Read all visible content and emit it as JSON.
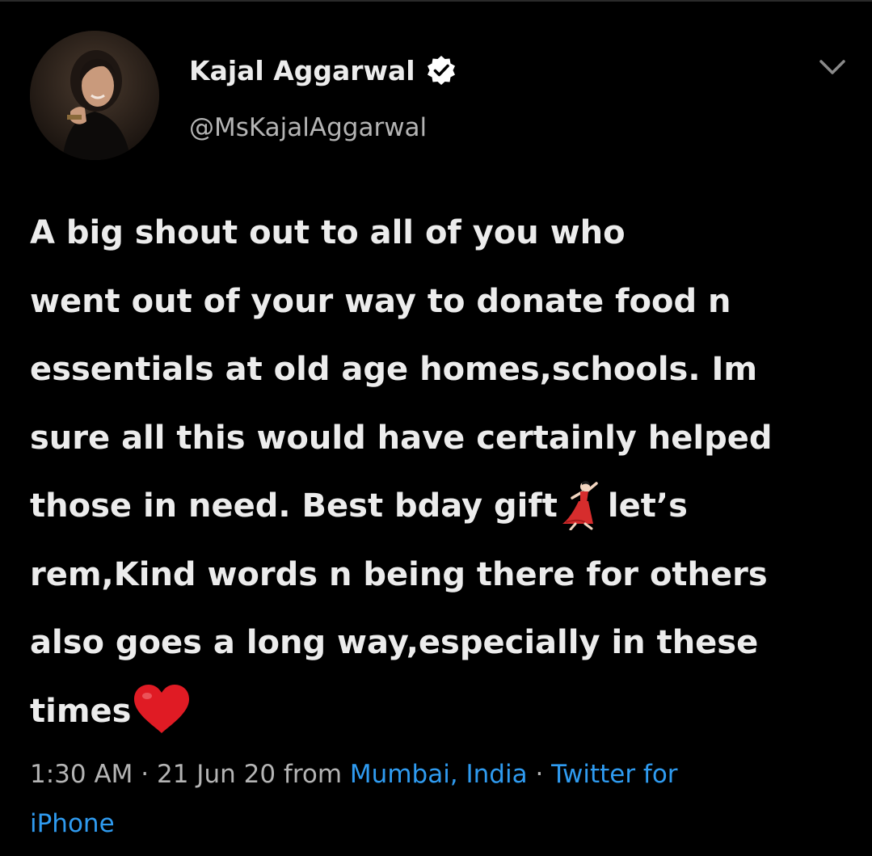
{
  "author": {
    "display_name": "Kajal Aggarwal",
    "handle": "@MsKajalAggarwal",
    "verified": true
  },
  "tweet": {
    "lines": [
      "A big shout out to all of you who",
      "went out of your way to donate food n",
      "essentials at old age homes,schools. Im",
      "sure all this would have certainly helped",
      "those in need. Best bday gift",
      "let’s",
      "rem,Kind words n being there for others",
      "also goes a long way,especially in these",
      "times"
    ],
    "emojis": [
      "dancing-woman-emoji",
      "red-heart-emoji"
    ]
  },
  "meta": {
    "time": "1:30 AM",
    "separator": "·",
    "date": "21 Jun 20",
    "from_label": "from",
    "location": "Mumbai, India",
    "source_line1": "Twitter for",
    "source_line2": "iPhone"
  },
  "colors": {
    "background": "#000000",
    "text": "#ececec",
    "secondary": "#b4b4b4",
    "link": "#2f9bf0",
    "verified_badge": "#ffffff"
  }
}
